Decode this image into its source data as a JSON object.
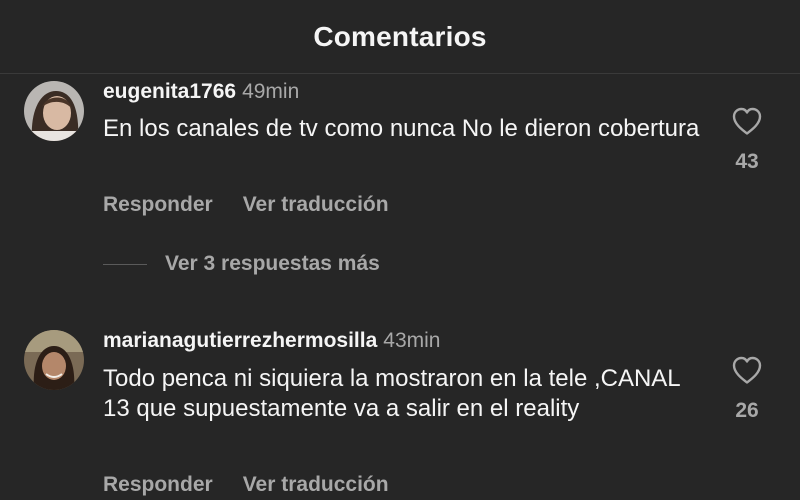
{
  "header": {
    "title": "Comentarios"
  },
  "comments": [
    {
      "username": "eugenita1766",
      "time": "49min",
      "text": "En los canales de tv como nunca No le dieron cobertura",
      "likes": "43",
      "reply_label": "Responder",
      "translate_label": "Ver traducción",
      "replies_label": "Ver 3 respuestas más"
    },
    {
      "username": "marianagutierrezhermosilla",
      "time": "43min",
      "text": "Todo penca ni siquiera la mostraron en la tele ,CANAL 13 que supuestamente va a salir en el reality",
      "likes": "26",
      "reply_label": "Responder",
      "translate_label": "Ver traducción"
    }
  ],
  "icons": {
    "like": "heart-outline-icon"
  },
  "colors": {
    "background": "#262626",
    "primary_text": "#f5f5f5",
    "secondary_text": "#a8a8a8"
  }
}
